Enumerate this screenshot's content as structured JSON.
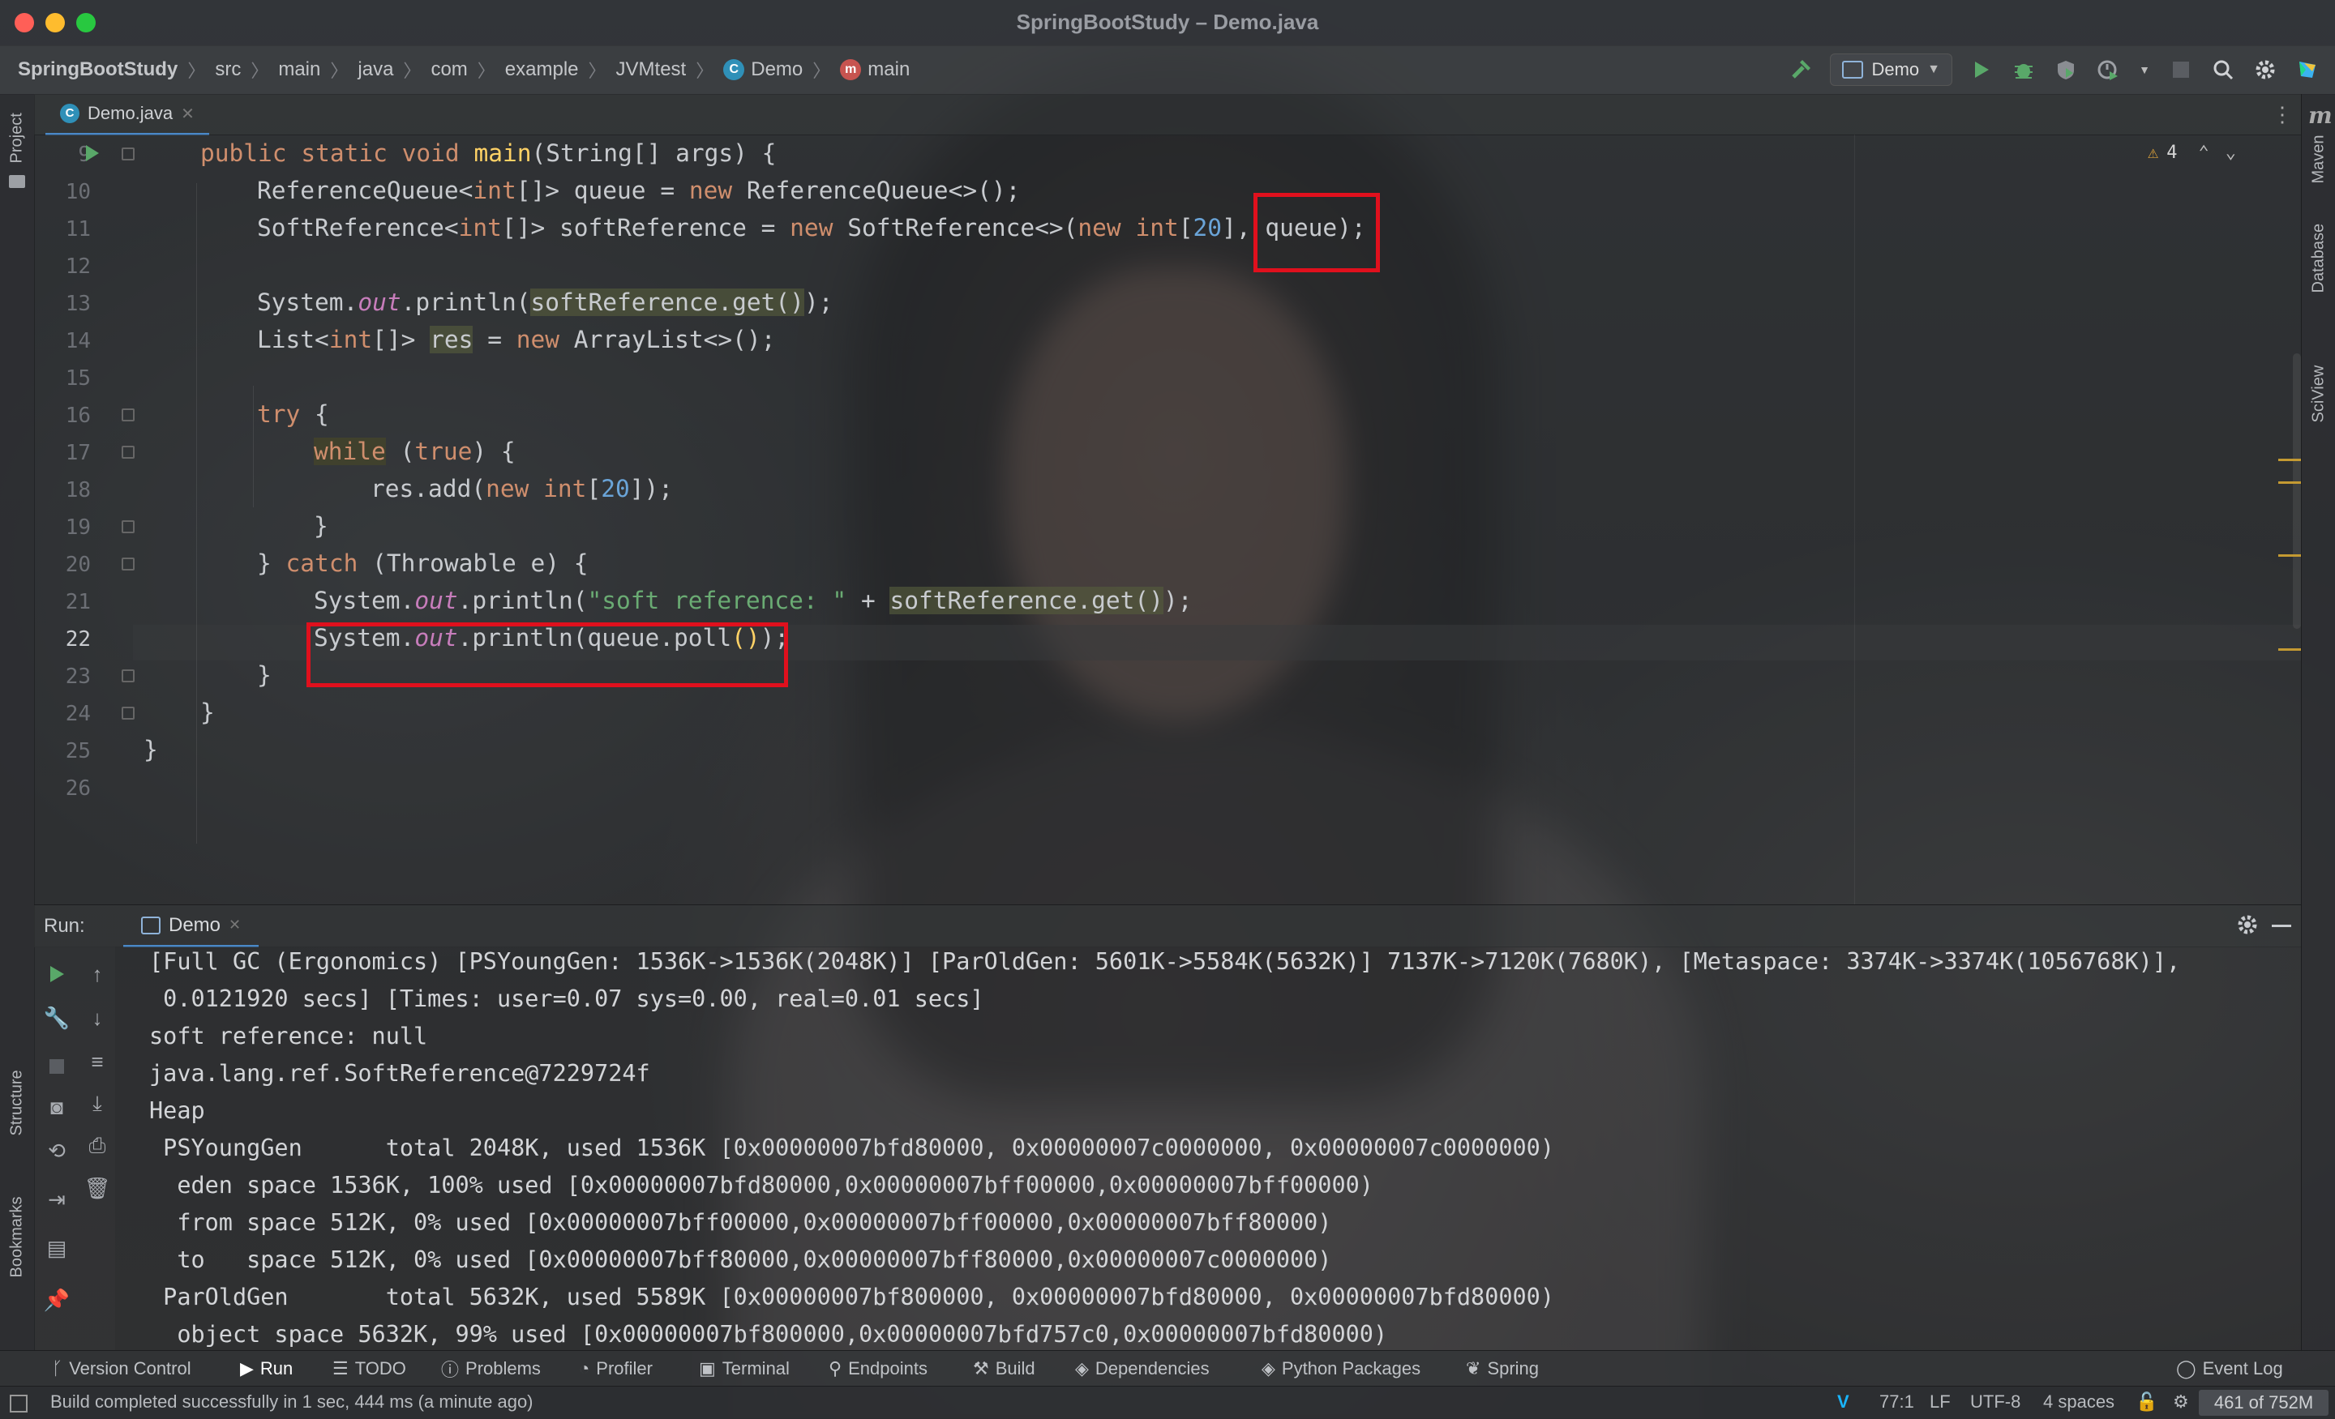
{
  "window": {
    "title": "SpringBootStudy – Demo.java"
  },
  "breadcrumbs": [
    "SpringBootStudy",
    "src",
    "main",
    "java",
    "com",
    "example",
    "JVMtest",
    "Demo",
    "main"
  ],
  "toolbar": {
    "run_config": "Demo"
  },
  "editor": {
    "tab": "Demo.java",
    "warnings_count": "4",
    "current_line": 22,
    "lines": [
      {
        "n": "9"
      },
      {
        "n": "10"
      },
      {
        "n": "11"
      },
      {
        "n": "12"
      },
      {
        "n": "13"
      },
      {
        "n": "14"
      },
      {
        "n": "15"
      },
      {
        "n": "16"
      },
      {
        "n": "17"
      },
      {
        "n": "18"
      },
      {
        "n": "19"
      },
      {
        "n": "20"
      },
      {
        "n": "21"
      },
      {
        "n": "22"
      },
      {
        "n": "23"
      },
      {
        "n": "24"
      },
      {
        "n": "25"
      },
      {
        "n": "26"
      }
    ],
    "code": {
      "l9": [
        "public static void ",
        "main",
        "(String[] args) {"
      ],
      "l10": [
        "ReferenceQueue<",
        "int",
        "[]> queue = ",
        "new",
        " ReferenceQueue<>();"
      ],
      "l11": [
        "SoftReference<",
        "int",
        "[]> softReference = ",
        "new",
        " SoftReference<>(",
        "new",
        " ",
        "int",
        "[",
        "20",
        "], ",
        "queue);"
      ],
      "l13": [
        "System.",
        "out",
        ".println(",
        "softReference.get()",
        ");"
      ],
      "l14": [
        "List<",
        "int",
        "[]> ",
        "res",
        " = ",
        "new",
        " ArrayList<>();"
      ],
      "l16": [
        "try",
        " {"
      ],
      "l17": [
        "while",
        " (",
        "true",
        ") {"
      ],
      "l18": [
        "res.add(",
        "new",
        " ",
        "int",
        "[",
        "20",
        "]);"
      ],
      "l19": [
        "}"
      ],
      "l20": [
        "} ",
        "catch",
        " (Throwable e) {"
      ],
      "l21": [
        "System.",
        "out",
        ".println(",
        "\"soft reference: \"",
        " + ",
        "softReference.get()",
        ");"
      ],
      "l22": [
        "System.",
        "out",
        ".println(queue.poll",
        "()",
        ");"
      ],
      "l23": [
        "}"
      ],
      "l24": [
        "}"
      ],
      "l25": [
        "}"
      ]
    }
  },
  "run": {
    "label": "Run:",
    "tab": "Demo",
    "console": [
      "[Full GC (Ergonomics) [PSYoungGen: 1536K->1536K(2048K)] [ParOldGen: 5601K->5584K(5632K)] 7137K->7120K(7680K), [Metaspace: 3374K->3374K(1056768K)],",
      " 0.0121920 secs] [Times: user=0.07 sys=0.00, real=0.01 secs]",
      "soft reference: null",
      "java.lang.ref.SoftReference@7229724f",
      "Heap",
      " PSYoungGen      total 2048K, used 1536K [0x00000007bfd80000, 0x00000007c0000000, 0x00000007c0000000)",
      "  eden space 1536K, 100% used [0x00000007bfd80000,0x00000007bff00000,0x00000007bff00000)",
      "  from space 512K, 0% used [0x00000007bff00000,0x00000007bff00000,0x00000007bff80000)",
      "  to   space 512K, 0% used [0x00000007bff80000,0x00000007bff80000,0x00000007c0000000)",
      " ParOldGen       total 5632K, used 5589K [0x00000007bf800000, 0x00000007bfd80000, 0x00000007bfd80000)",
      "  object space 5632K, 99% used [0x00000007bf800000,0x00000007bfd757c0,0x00000007bfd80000)"
    ]
  },
  "side_left": {
    "project": "Project",
    "structure": "Structure",
    "bookmarks": "Bookmarks"
  },
  "side_right": {
    "maven": "Maven",
    "database": "Database",
    "sciview": "SciView"
  },
  "bottom_tabs": [
    "Version Control",
    "Run",
    "TODO",
    "Problems",
    "Profiler",
    "Terminal",
    "Endpoints",
    "Build",
    "Dependencies",
    "Python Packages",
    "Spring",
    "Event Log"
  ],
  "status": {
    "message": "Build completed successfully in 1 sec, 444 ms (a minute ago)",
    "position": "77:1",
    "line_sep": "LF",
    "encoding": "UTF-8",
    "indent": "4 spaces",
    "memory": "461 of 752M"
  },
  "colors": {
    "accent": "#4a88c7",
    "highlight_box": "#e0101d",
    "keyword": "#cf8e6d",
    "number": "#6aa4d8",
    "string": "#6aab73"
  }
}
